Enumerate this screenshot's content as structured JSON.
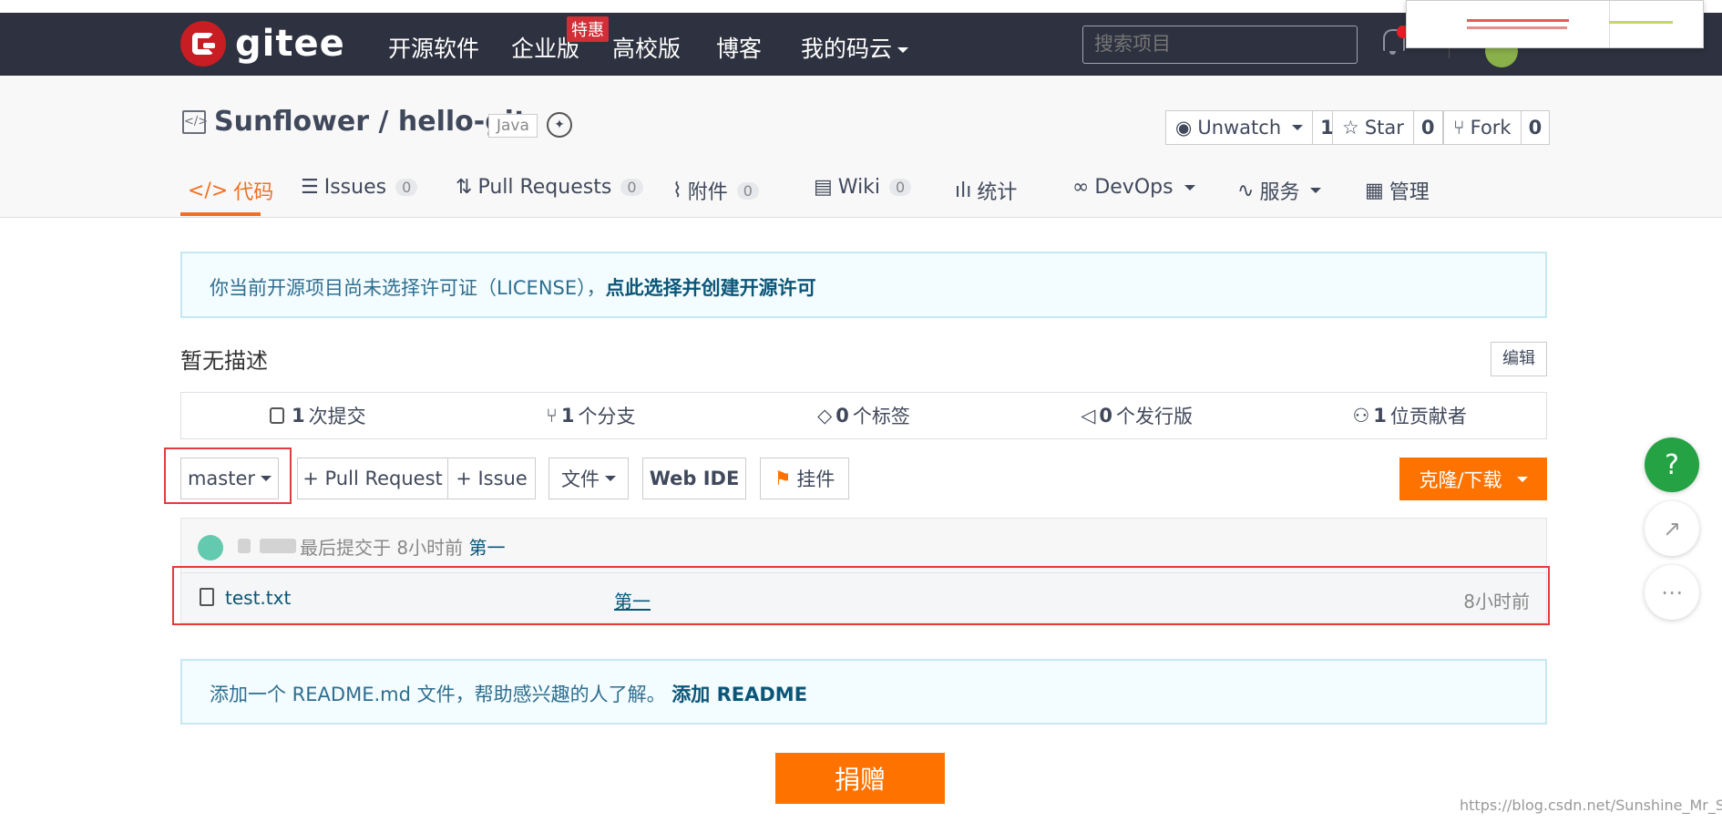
{
  "nav": {
    "logo": "gitee",
    "items": [
      "开源软件",
      "企业版",
      "高校版",
      "博客",
      "我的码云"
    ],
    "badge": "特惠",
    "search_placeholder": "搜索项目"
  },
  "repo": {
    "owner_name": "Sunflower / hello-git",
    "language": "Java",
    "unwatch": {
      "label": "Unwatch",
      "count": "1"
    },
    "star": {
      "label": "Star",
      "count": "0"
    },
    "fork": {
      "label": "Fork",
      "count": "0"
    }
  },
  "tabs": [
    {
      "label": "代码",
      "count": ""
    },
    {
      "label": "Issues",
      "count": "0"
    },
    {
      "label": "Pull Requests",
      "count": "0"
    },
    {
      "label": "附件",
      "count": "0"
    },
    {
      "label": "Wiki",
      "count": "0"
    },
    {
      "label": "统计",
      "count": ""
    },
    {
      "label": "DevOps",
      "count": ""
    },
    {
      "label": "服务",
      "count": ""
    },
    {
      "label": "管理",
      "count": ""
    }
  ],
  "license_notice": {
    "text": "你当前开源项目尚未选择许可证（LICENSE），",
    "link": "点此选择并创建开源许可"
  },
  "description": "暂无描述",
  "edit_label": "编辑",
  "stats": [
    {
      "num": "1",
      "label": "次提交"
    },
    {
      "num": "1",
      "label": "个分支"
    },
    {
      "num": "0",
      "label": "个标签"
    },
    {
      "num": "0",
      "label": "个发行版"
    },
    {
      "num": "1",
      "label": "位贡献者"
    }
  ],
  "toolbar": {
    "branch": "master",
    "pull_request": "+ Pull Request",
    "issue": "+ Issue",
    "file": "文件",
    "web_ide": "Web IDE",
    "widget": "挂件",
    "clone": "克隆/下载"
  },
  "commit": {
    "text": "最后提交于 8小时前",
    "message": "第一"
  },
  "files": [
    {
      "name": "test.txt",
      "message": "第一",
      "time": "8小时前"
    }
  ],
  "readme_notice": {
    "text": "添加一个 README.md 文件，帮助感兴趣的人了解。",
    "link": "添加 README"
  },
  "donate": "捐赠",
  "help": "?",
  "watermark": "https://blog.csdn.net/Sunshine_Mr_Sun"
}
